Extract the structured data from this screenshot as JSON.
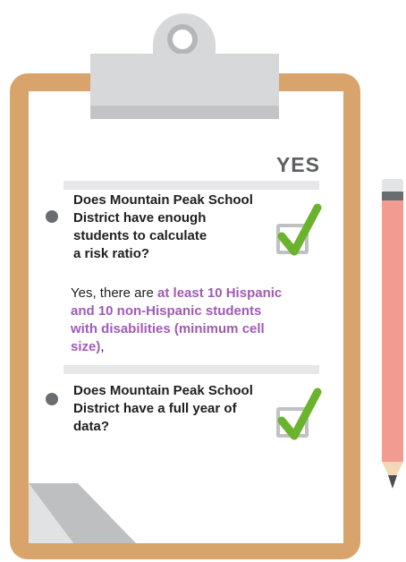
{
  "colors": {
    "board": "#d9a46b",
    "clip": "#d6d8da",
    "accent_purple": "#a05ab8",
    "check_green": "#6ab42d",
    "pencil_pink": "#f29b91"
  },
  "checklist": {
    "header": "YES",
    "items": [
      {
        "question_lines": [
          "Does Mountain Peak School",
          "District have enough",
          "students to calculate",
          "a risk ratio?"
        ],
        "checked": true,
        "answer": {
          "prefix": "Yes, there are ",
          "highlight": "at least 10 Hispanic and 10 non-Hispanic students with disabilities (minimum cell size)",
          "suffix": ","
        }
      },
      {
        "question_lines": [
          "Does Mountain Peak School",
          "District have a full year of",
          "data?"
        ],
        "checked": true
      }
    ]
  }
}
